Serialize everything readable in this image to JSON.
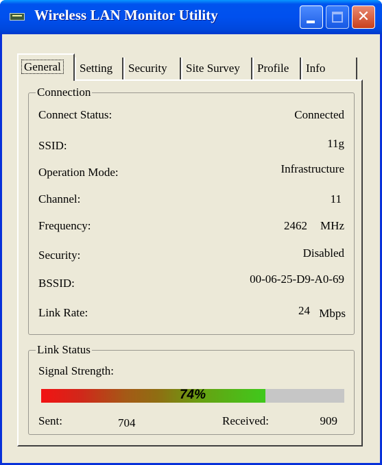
{
  "window": {
    "title": "Wireless LAN Monitor Utility"
  },
  "tabs": [
    "General",
    "Setting",
    "Security",
    "Site Survey",
    "Profile",
    "Info"
  ],
  "active_tab": "General",
  "connection": {
    "group_label": "Connection",
    "rows": [
      {
        "label": "Connect Status:",
        "value": "Connected"
      },
      {
        "label": "SSID:",
        "value": "11g"
      },
      {
        "label": "Operation Mode:",
        "value": "Infrastructure"
      },
      {
        "label": "Channel:",
        "value": "11"
      },
      {
        "label": "Frequency:",
        "value": "2462",
        "unit": "MHz"
      },
      {
        "label": "Security:",
        "value": "Disabled"
      },
      {
        "label": "BSSID:",
        "value": "00-06-25-D9-A0-69"
      },
      {
        "label": "Link Rate:",
        "value": "24",
        "unit": "Mbps"
      }
    ]
  },
  "link_status": {
    "group_label": "Link Status",
    "signal_label": "Signal Strength:",
    "signal_percent": 74,
    "signal_text": "74%",
    "sent_label": "Sent:",
    "sent_value": "704",
    "received_label": "Received:",
    "received_value": "909"
  },
  "colors": {
    "titlebar": "#0050ee",
    "window_bg": "#ece9d8",
    "signal_high": "#3fc91c",
    "signal_low": "#f21313"
  }
}
